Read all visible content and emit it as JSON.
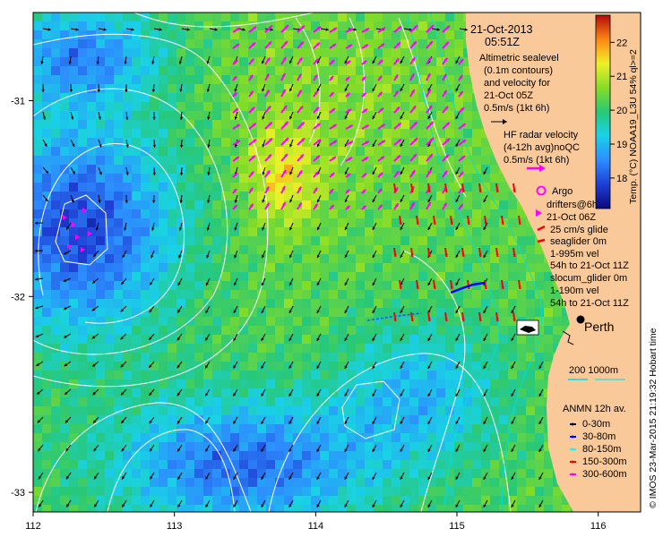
{
  "header": {
    "date": "21-Oct-2013",
    "time": "05:51Z"
  },
  "altimetry": {
    "lines": [
      "Altimetric sealevel",
      "(0.1m contours)",
      "and velocity for",
      "21-Oct 05Z",
      "0.5m/s (1kt 6h)"
    ]
  },
  "hf_radar": {
    "lines": [
      "HF radar velocity",
      "(4-12h avg)noQC",
      "0.5m/s (1kt 6h)"
    ]
  },
  "legend": {
    "argo": "Argo",
    "drifters": [
      "drifters@6h to",
      "21-Oct 06Z"
    ],
    "glide": "25 cm/s glide",
    "seaglider": [
      "seaglider 0m",
      "1-995m vel",
      "54h to 21-Oct 11Z"
    ],
    "slocum": [
      "slocum_glider 0m",
      "1-190m vel",
      "54h to 21-Oct 11Z"
    ],
    "isobaths": "200  1000m",
    "anmn_title": "ANMN 12h av.",
    "anmn_items": [
      {
        "label": "0-30m",
        "color": "#000000"
      },
      {
        "label": "30-80m",
        "color": "#0000ff"
      },
      {
        "label": "80-150m",
        "color": "#00ffff"
      },
      {
        "label": "150-300m",
        "color": "#ff0000"
      },
      {
        "label": "300-600m",
        "color": "#ff00ff"
      }
    ]
  },
  "place": "Perth",
  "axes": {
    "x_ticks": [
      "112",
      "113",
      "114",
      "115",
      "116"
    ],
    "y_ticks": [
      "-31",
      "-32",
      "-33"
    ],
    "lon_range": [
      112,
      116.3
    ],
    "lat_range": [
      -33.1,
      -30.55
    ]
  },
  "colorbar": {
    "ticks": [
      "22",
      "21",
      "20",
      "19",
      "18"
    ],
    "title": "Temp. (°C) NOAA19_L3U 54% ql>=2",
    "range": [
      17.1,
      22.8
    ]
  },
  "credit": "© IMOS 23-Mar-2015 21:19:32 Hobart time",
  "colors": {
    "land": "#fac99a",
    "argo": "#ff00ff",
    "hf": "#ff00ff",
    "drifter": "#ff00ff",
    "glide": "#ff0000",
    "seaglider": "#0000ff",
    "contour": "#ffffff",
    "isobath200": "#00e0e0",
    "isobath1000": "#00e0e0"
  }
}
